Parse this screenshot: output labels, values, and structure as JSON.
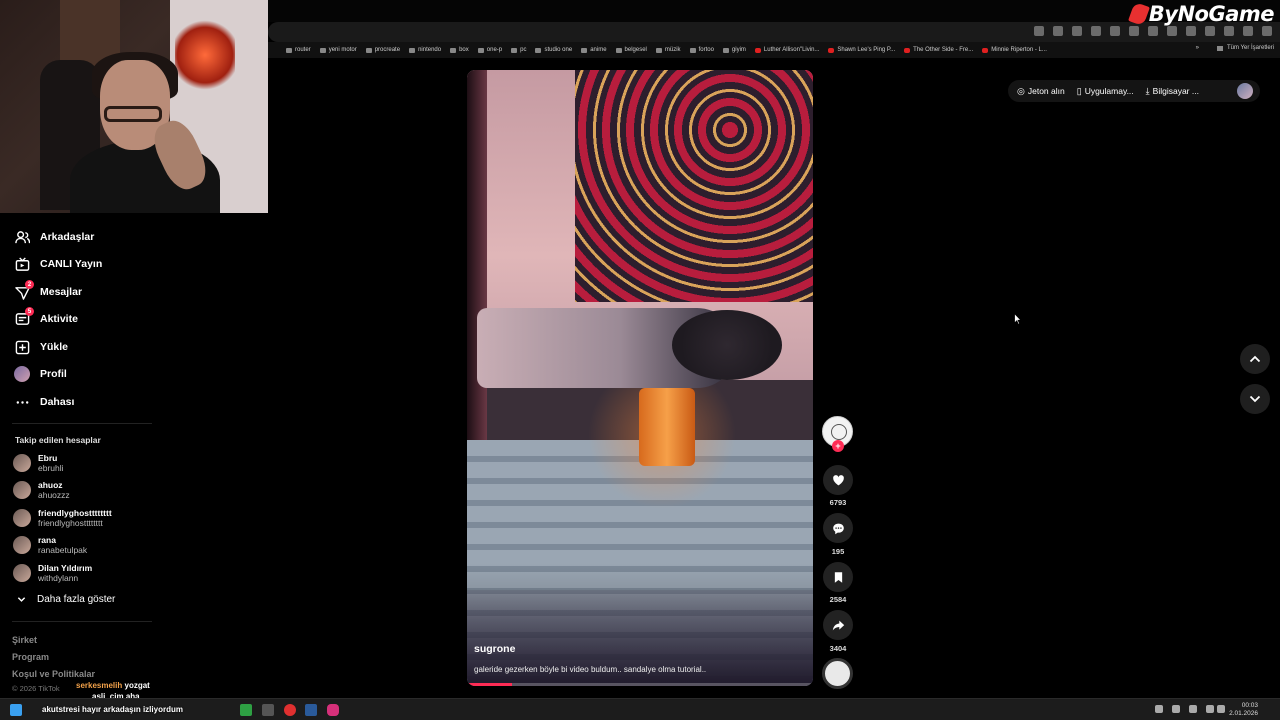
{
  "watermark": "ByNoGame",
  "bookmarks": [
    {
      "label": "router",
      "type": "folder"
    },
    {
      "label": "yeni motor",
      "type": "folder"
    },
    {
      "label": "procreate",
      "type": "folder"
    },
    {
      "label": "nintendo",
      "type": "folder"
    },
    {
      "label": "box",
      "type": "folder"
    },
    {
      "label": "one-p",
      "type": "folder"
    },
    {
      "label": "pc",
      "type": "folder"
    },
    {
      "label": "studio one",
      "type": "folder"
    },
    {
      "label": "anime",
      "type": "folder"
    },
    {
      "label": "belgesel",
      "type": "folder"
    },
    {
      "label": "müzik",
      "type": "folder"
    },
    {
      "label": "fortoo",
      "type": "folder"
    },
    {
      "label": "giyim",
      "type": "folder"
    },
    {
      "label": "Luther Allison\"Livin...",
      "type": "yt"
    },
    {
      "label": "Shawn Lee's Ping P...",
      "type": "yt"
    },
    {
      "label": "The Other Side - Fre...",
      "type": "yt"
    },
    {
      "label": "Minnie Riperton - L...",
      "type": "yt"
    }
  ],
  "bookmarks_more": "»",
  "bookmarks_all": "Tüm Yer İşaretleri",
  "sidebar": {
    "nav": [
      {
        "label": "Arkadaşlar",
        "icon": "friends-icon"
      },
      {
        "label": "CANLI Yayın",
        "icon": "live-icon"
      },
      {
        "label": "Mesajlar",
        "icon": "messages-icon",
        "badge": "2"
      },
      {
        "label": "Aktivite",
        "icon": "activity-icon",
        "badge": "5"
      },
      {
        "label": "Yükle",
        "icon": "upload-icon"
      },
      {
        "label": "Profil",
        "icon": "profile-avatar"
      },
      {
        "label": "Dahası",
        "icon": "more-icon"
      }
    ],
    "following_title": "Takip edilen hesaplar",
    "following": [
      {
        "name": "Ebru",
        "handle": "ebruhli"
      },
      {
        "name": "ahuoz",
        "handle": "ahuozzz"
      },
      {
        "name": "friendlyghostttttttt",
        "handle": "friendlyghostttttttt"
      },
      {
        "name": "rana",
        "handle": "ranabetulpak"
      },
      {
        "name": "Dilan Yıldırım",
        "handle": "withdylann"
      }
    ],
    "show_more": "Daha fazla göster",
    "footer": [
      "Şirket",
      "Program",
      "Koşul ve Politikalar"
    ],
    "copyright": "© 2026 TikTok"
  },
  "topbar": {
    "coins": "Jeton alın",
    "app": "Uygulamay...",
    "desktop": "Bilgisayar ..."
  },
  "video": {
    "author": "sugrone",
    "caption": "galeride gezerken böyle bi video buldum.. sandalye olma tutorial..",
    "progress": 0.13
  },
  "actions": {
    "likes": "6793",
    "comments": "195",
    "saves": "2584",
    "shares": "3404"
  },
  "chat": [
    {
      "name": "serkesmelih",
      "message": "yozgat"
    },
    {
      "name": "asli_cim",
      "message": "aha"
    },
    {
      "name": "akutstresi",
      "message": "hayır arkadaşın izliyordum"
    }
  ],
  "clock": {
    "time": "00:03",
    "date": "2.01.2026"
  },
  "colors": {
    "accent": "#fe2c55",
    "background": "#000000"
  }
}
